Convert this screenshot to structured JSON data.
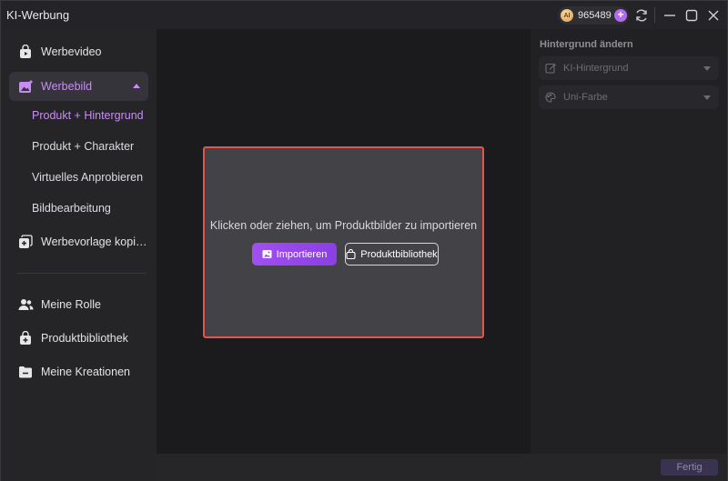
{
  "app": {
    "title": "KI-Werbung"
  },
  "titlebar": {
    "credits": "965489",
    "coin_label": "AI",
    "plus_label": "+"
  },
  "sidebar": {
    "items": [
      {
        "label": "Werbevideo",
        "icon": "video-bag-icon"
      },
      {
        "label": "Werbebild",
        "icon": "image-sparkle-icon",
        "active": true
      },
      {
        "label": "Werbevorlage kopieren",
        "icon": "copy-template-icon"
      }
    ],
    "sub_items": [
      {
        "label": "Produkt + Hintergrund",
        "active": true
      },
      {
        "label": "Produkt + Charakter"
      },
      {
        "label": "Virtuelles Anprobieren"
      },
      {
        "label": "Bildbearbeitung"
      }
    ],
    "bottom_items": [
      {
        "label": "Meine Rolle",
        "icon": "users-icon"
      },
      {
        "label": "Produktbibliothek",
        "icon": "product-bag-icon"
      },
      {
        "label": "Meine Kreationen",
        "icon": "folder-icon"
      }
    ]
  },
  "main": {
    "drop_text": "Klicken oder ziehen, um Produktbilder zu importieren",
    "import_label": "Importieren",
    "library_label": "Produktbibliothek"
  },
  "panel": {
    "title": "Hintergrund ändern",
    "options": [
      {
        "label": "KI-Hintergrund",
        "icon": "edit-icon"
      },
      {
        "label": "Uni-Farbe",
        "icon": "palette-icon"
      }
    ]
  },
  "footer": {
    "done_label": "Fertig"
  },
  "colors": {
    "accent": "#a14ff0",
    "active_text": "#c98cf5",
    "highlight_border": "#e0554d"
  }
}
